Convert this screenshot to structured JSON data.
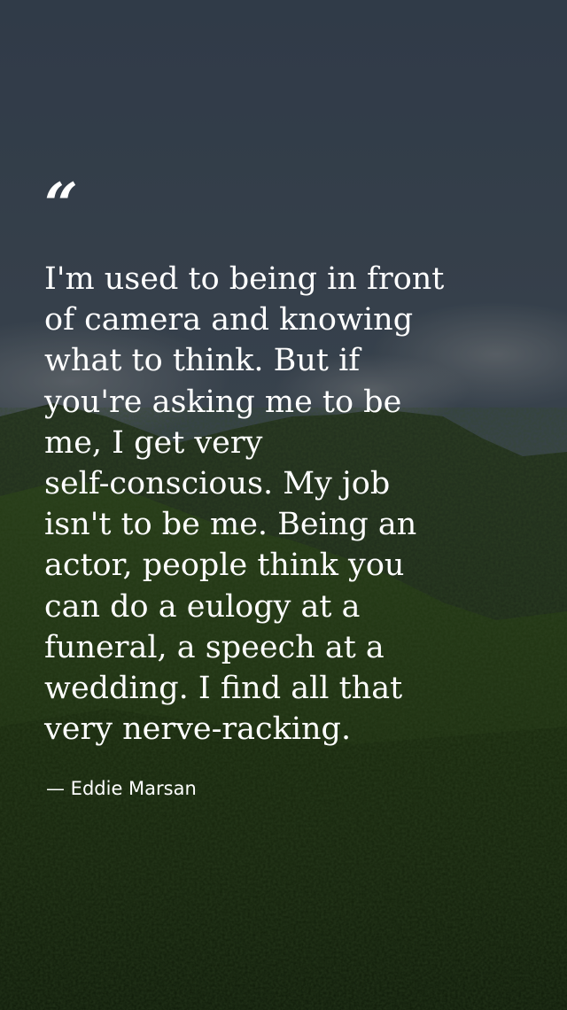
{
  "quote": {
    "mark": "“",
    "text": "I'm used to being in front\nof camera and knowing\nwhat to think. But if\nyou're asking me to be\nme, I get very\nself-conscious. My job\nisn't to be me. Being an\nactor, people think you\ncan do a eulogy at a\nfuneral, a speech at a\nwedding. I find all that\nvery nerve-racking.",
    "attribution": "— Eddie Marsan"
  },
  "background": {
    "description_icon": "mountain-landscape-photo",
    "sky_color": "#3f4d5c",
    "hill_color": "#1c2c16",
    "grass_color": "#243a12"
  }
}
